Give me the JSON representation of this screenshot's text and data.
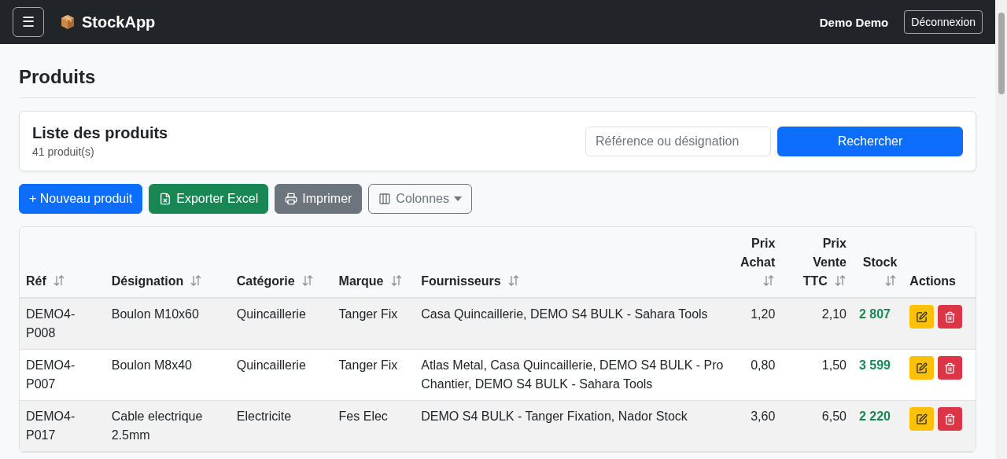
{
  "navbar": {
    "menu_button": "☰",
    "brand": "StockApp",
    "user": "Demo Demo",
    "logout": "Déconnexion"
  },
  "page_title": "Produits",
  "list_card": {
    "title": "Liste des produits",
    "count": "41 produit(s)",
    "search": {
      "placeholder": "Référence ou désignation"
    },
    "search_button": "Rechercher"
  },
  "toolbar": [
    {
      "label": "+ Nouveau produit",
      "kind": "primary"
    },
    {
      "label": "Exporter Excel",
      "kind": "excel"
    },
    {
      "label": "Imprimer",
      "kind": "print"
    },
    {
      "label": "Colonnes",
      "kind": "columns"
    }
  ],
  "table": {
    "columns": [
      {
        "label": "Réf",
        "kind": "text",
        "sortable": true
      },
      {
        "label": "Désignation",
        "kind": "text",
        "sortable": true
      },
      {
        "label": "Catégorie",
        "kind": "text",
        "sortable": true
      },
      {
        "label": "Marque",
        "kind": "text",
        "sortable": true
      },
      {
        "label": "Fournisseurs",
        "kind": "text",
        "sortable": true
      },
      {
        "label": "Prix Achat",
        "kind": "number",
        "sortable": true
      },
      {
        "label": "Prix Vente TTC",
        "kind": "number",
        "sortable": true
      },
      {
        "label": "Stock",
        "kind": "stock",
        "sortable": true
      },
      {
        "label": "Actions",
        "kind": "actions",
        "sortable": false
      }
    ],
    "rows": [
      {
        "cells": [
          "DEMO4-P008",
          "Boulon M10x60",
          "Quincaillerie",
          "Tanger Fix",
          "Casa Quincaillerie, DEMO S4 BULK - Sahara Tools",
          "1,20",
          "2,10",
          "2 807"
        ]
      },
      {
        "cells": [
          "DEMO4-P007",
          "Boulon M8x40",
          "Quincaillerie",
          "Tanger Fix",
          "Atlas Metal, Casa Quincaillerie, DEMO S4 BULK - Pro Chantier, DEMO S4 BULK - Sahara Tools",
          "0,80",
          "1,50",
          "3 599"
        ]
      },
      {
        "cells": [
          "DEMO4-P017",
          "Cable electrique 2.5mm",
          "Electricite",
          "Fes Elec",
          "DEMO S4 BULK - Tanger Fixation, Nador Stock",
          "3,60",
          "6,50",
          "2 220"
        ]
      }
    ]
  }
}
